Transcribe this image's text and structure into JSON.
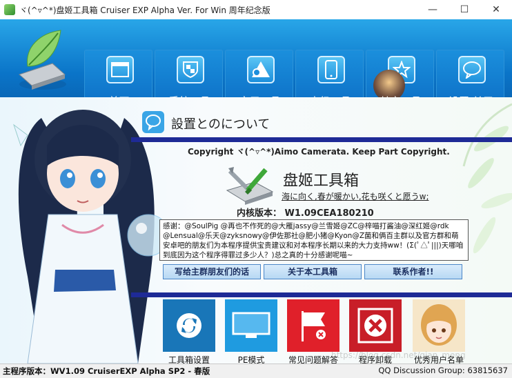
{
  "window": {
    "title": "ヾ(^▿^*)盘姬工具箱 Cruiser EXP Alpha Ver. For Win 周年纪念版",
    "controls": {
      "minimize": "—",
      "maximize": "☐",
      "close": "✕"
    }
  },
  "nav": {
    "items": [
      {
        "label": "首页",
        "icon": "home-icon"
      },
      {
        "label": "系统工具",
        "icon": "shield-icon"
      },
      {
        "label": "实用工具",
        "icon": "shapes-icon"
      },
      {
        "label": "高级工具",
        "icon": "phone-icon"
      },
      {
        "label": "其它工具",
        "icon": "star-icon"
      },
      {
        "label": "设置/关于",
        "icon": "chat-icon"
      }
    ]
  },
  "about": {
    "section_title": "設置とのについて",
    "copyright": "Copyright ヾ(^▿^*)Aimo Camerata. Keep Part Copyright.",
    "program_name": "盘姬工具箱",
    "slogan": "海に向く,春が暖かい,花も咲くと愿うw;",
    "kernel_label": "内核版本：",
    "kernel_version": "W1.09CEA180210",
    "thanks_text": "感谢：@SoulPig @再也不作死的@大雁jassy@兰雪姬@ZC@梓喵打酱油@深红姬@rdk @Lensual@乐天@zyksnowy@伊佐那社@肥小猪@Kyon@Z菌和俩百主群以及官方群和萌安卓吧的朋友们为本程序提供宝贵建议和对本程序长期以来的大力支持ww！(Σ(ﾟ△ﾟ|||)天哪咱到底因为这个程序得罪过多少人？)总之真的十分感谢呢喵~",
    "buttons": {
      "write_friends": "写给主群朋友们的话",
      "about_tool": "关于本工具箱",
      "contact_author": "联系作者!!"
    }
  },
  "tiles": [
    {
      "label": "工具箱设置",
      "icon": "sync-icon",
      "color": "#1976b8"
    },
    {
      "label": "PE模式",
      "icon": "monitor-icon",
      "color": "#1f9be0"
    },
    {
      "label": "常见问题解答",
      "icon": "flag-icon",
      "color": "#e0202a"
    },
    {
      "label": "程序卸载",
      "icon": "uninstall-icon",
      "color": "#c81e28"
    },
    {
      "label": "优秀用户名单",
      "icon": "anime-girl-icon",
      "color": "#f6e6c8"
    }
  ],
  "status": {
    "main_version_label": "主程序版本：",
    "main_version": "WV1.09 CruiserEXP Alpha SP2 - 春版",
    "qq_group": "QQ Discussion Group: 63815637"
  },
  "watermark": "https://blog.csdn.net/qian_meng"
}
